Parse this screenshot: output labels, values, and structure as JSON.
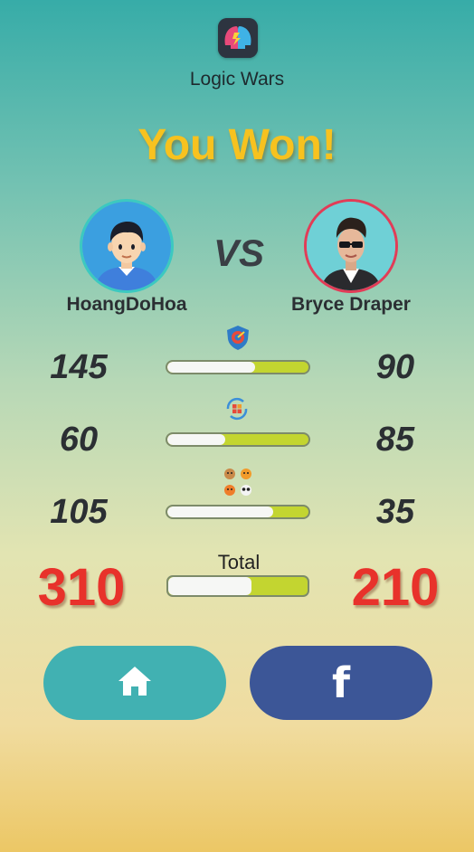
{
  "app": {
    "title": "Logic Wars"
  },
  "headline": "You Won!",
  "vs_label": "VS",
  "players": {
    "left": {
      "name": "HoangDoHoa"
    },
    "right": {
      "name": "Bryce Draper"
    }
  },
  "stats": [
    {
      "icon": "shield-target-icon",
      "left": "145",
      "right": "90",
      "left_share": 0.62
    },
    {
      "icon": "rotate-grid-icon",
      "left": "60",
      "right": "85",
      "left_share": 0.41
    },
    {
      "icon": "animal-faces-icon",
      "left": "105",
      "right": "35",
      "left_share": 0.75
    }
  ],
  "total": {
    "label": "Total",
    "left": "310",
    "right": "210",
    "left_share": 0.6
  },
  "buttons": {
    "home_icon": "home-icon",
    "facebook_icon": "facebook-icon"
  },
  "colors": {
    "headline": "#f7c21f",
    "total_score": "#e8322b",
    "bar_fill": "#c3d530",
    "home_button": "#41b1b2",
    "facebook_button": "#3c5697"
  }
}
